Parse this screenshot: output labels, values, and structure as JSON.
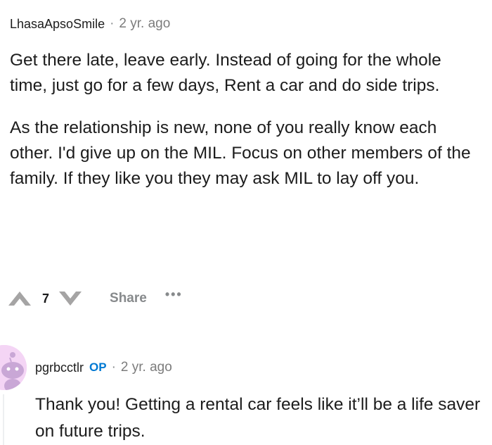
{
  "comment1": {
    "author": "LhasaApsoSmile",
    "separator": "·",
    "timestamp": "2 yr. ago",
    "paragraphs": [
      "Get there late, leave early. Instead of going for the whole time, just go for a few days, Rent a car and do side trips.",
      "As the relationship is new, none of you really know each other. I'd give up on the MIL. Focus on other members of the family. If they like you they may ask MIL to lay off you."
    ],
    "score": "7",
    "share_label": "Share",
    "more_label": "•••"
  },
  "comment2": {
    "author": "pgrbcctlr",
    "op_badge": "OP",
    "separator": "·",
    "timestamp": "2 yr. ago",
    "paragraphs": [
      "Thank you! Getting a rental car feels like it’ll be a life saver on future trips."
    ]
  },
  "icons": {
    "upvote": "upvote-arrow-icon",
    "downvote": "downvote-arrow-icon",
    "more": "more-options-icon",
    "avatar": "snoo-avatar"
  },
  "colors": {
    "op_badge": "#0079d3",
    "meta_text": "#7c7c7c",
    "action_text": "#878a8c",
    "avatar_bg": "#f4d5f5"
  }
}
